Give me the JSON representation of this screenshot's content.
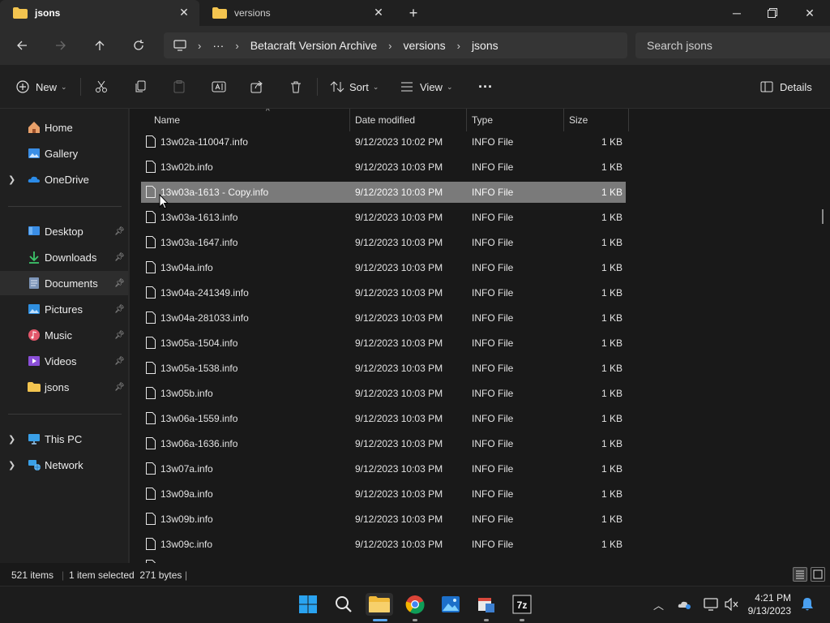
{
  "tabs": [
    {
      "label": "jsons",
      "active": true
    },
    {
      "label": "versions",
      "active": false
    }
  ],
  "breadcrumb": {
    "overflow": "···",
    "segments": [
      "Betacraft Version Archive",
      "versions",
      "jsons"
    ]
  },
  "search": {
    "placeholder": "Search jsons"
  },
  "toolbar": {
    "new_label": "New",
    "sort_label": "Sort",
    "view_label": "View",
    "more_label": "···",
    "details_label": "Details"
  },
  "sidebar": {
    "quick": [
      {
        "label": "Home",
        "icon": "home-icon"
      },
      {
        "label": "Gallery",
        "icon": "gallery-icon"
      },
      {
        "label": "OneDrive",
        "icon": "onedrive-icon"
      }
    ],
    "pinned": [
      {
        "label": "Desktop",
        "icon": "desktop-icon"
      },
      {
        "label": "Downloads",
        "icon": "downloads-icon"
      },
      {
        "label": "Documents",
        "icon": "documents-icon"
      },
      {
        "label": "Pictures",
        "icon": "pictures-icon"
      },
      {
        "label": "Music",
        "icon": "music-icon"
      },
      {
        "label": "Videos",
        "icon": "videos-icon"
      },
      {
        "label": "jsons",
        "icon": "folder-icon"
      }
    ],
    "devices": [
      {
        "label": "This PC",
        "icon": "this-pc-icon"
      },
      {
        "label": "Network",
        "icon": "network-icon"
      }
    ]
  },
  "columns": {
    "name": "Name",
    "date": "Date modified",
    "type": "Type",
    "size": "Size"
  },
  "files": [
    {
      "name": "13w02a-110047.info",
      "date": "9/12/2023 10:02 PM",
      "type": "INFO File",
      "size": "1 KB"
    },
    {
      "name": "13w02b.info",
      "date": "9/12/2023 10:03 PM",
      "type": "INFO File",
      "size": "1 KB"
    },
    {
      "name": "13w03a-1613 - Copy.info",
      "date": "9/12/2023 10:03 PM",
      "type": "INFO File",
      "size": "1 KB",
      "selected": true
    },
    {
      "name": "13w03a-1613.info",
      "date": "9/12/2023 10:03 PM",
      "type": "INFO File",
      "size": "1 KB"
    },
    {
      "name": "13w03a-1647.info",
      "date": "9/12/2023 10:03 PM",
      "type": "INFO File",
      "size": "1 KB"
    },
    {
      "name": "13w04a.info",
      "date": "9/12/2023 10:03 PM",
      "type": "INFO File",
      "size": "1 KB"
    },
    {
      "name": "13w04a-241349.info",
      "date": "9/12/2023 10:03 PM",
      "type": "INFO File",
      "size": "1 KB"
    },
    {
      "name": "13w04a-281033.info",
      "date": "9/12/2023 10:03 PM",
      "type": "INFO File",
      "size": "1 KB"
    },
    {
      "name": "13w05a-1504.info",
      "date": "9/12/2023 10:03 PM",
      "type": "INFO File",
      "size": "1 KB"
    },
    {
      "name": "13w05a-1538.info",
      "date": "9/12/2023 10:03 PM",
      "type": "INFO File",
      "size": "1 KB"
    },
    {
      "name": "13w05b.info",
      "date": "9/12/2023 10:03 PM",
      "type": "INFO File",
      "size": "1 KB"
    },
    {
      "name": "13w06a-1559.info",
      "date": "9/12/2023 10:03 PM",
      "type": "INFO File",
      "size": "1 KB"
    },
    {
      "name": "13w06a-1636.info",
      "date": "9/12/2023 10:03 PM",
      "type": "INFO File",
      "size": "1 KB"
    },
    {
      "name": "13w07a.info",
      "date": "9/12/2023 10:03 PM",
      "type": "INFO File",
      "size": "1 KB"
    },
    {
      "name": "13w09a.info",
      "date": "9/12/2023 10:03 PM",
      "type": "INFO File",
      "size": "1 KB"
    },
    {
      "name": "13w09b.info",
      "date": "9/12/2023 10:03 PM",
      "type": "INFO File",
      "size": "1 KB"
    },
    {
      "name": "13w09c.info",
      "date": "9/12/2023 10:03 PM",
      "type": "INFO File",
      "size": "1 KB"
    }
  ],
  "status": {
    "count": "521 items",
    "selection": "1 item selected  271 bytes"
  },
  "clock": {
    "time": "4:21 PM",
    "date": "9/13/2023"
  },
  "colors": {
    "accent": "#0078d4",
    "folder": "#f3c44f",
    "selected_row": "#7a7a7a"
  }
}
